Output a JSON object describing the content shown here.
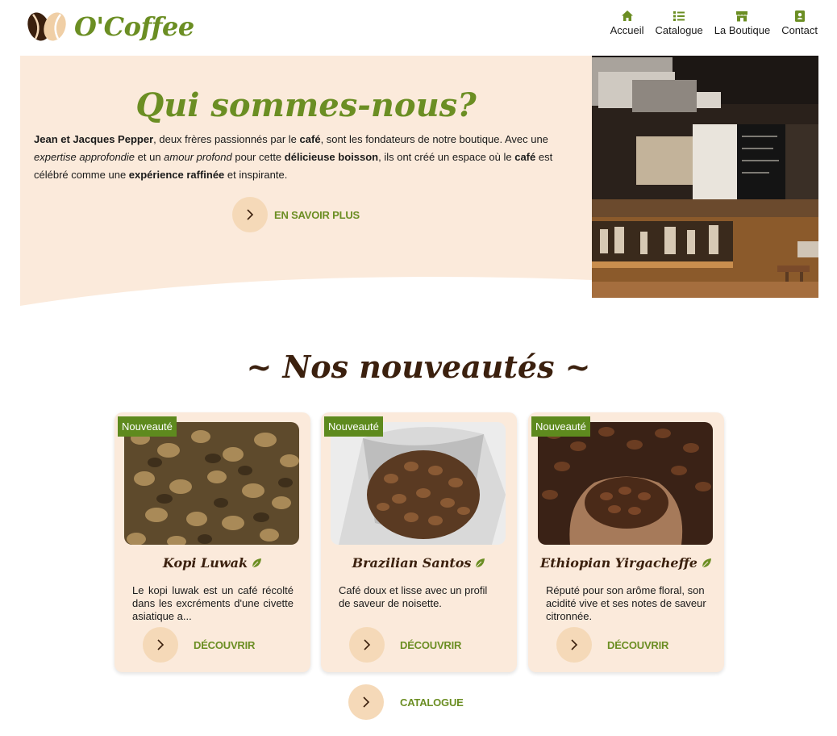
{
  "brand": {
    "name": "O'Coffee"
  },
  "nav": [
    {
      "label": "Accueil",
      "icon": "home-icon"
    },
    {
      "label": "Catalogue",
      "icon": "list-icon"
    },
    {
      "label": "La Boutique",
      "icon": "store-icon"
    },
    {
      "label": "Contact",
      "icon": "contact-card-icon"
    }
  ],
  "hero": {
    "title": "Qui sommes-nous?",
    "text_parts": [
      "Jean et Jacques Pepper",
      ", deux frères passionnés par le ",
      "café",
      ", sont les fondateurs de notre boutique. Avec une ",
      "expertise approfondie",
      " et un ",
      "amour profond",
      " pour cette ",
      "délicieuse boisson",
      ", ils ont créé un espace où le ",
      "café",
      " est célébré comme une ",
      "expérience raffinée",
      " et inspirante."
    ],
    "cta_label": "EN SAVOIR PLUS"
  },
  "section": {
    "title": "~ Nos nouveautés ~"
  },
  "products": [
    {
      "badge": "Nouveauté",
      "name": "Kopi Luwak",
      "description": "Le kopi luwak est un café récolté dans les excréments d'une civette asiatique a...",
      "cta": "DÉCOUVRIR"
    },
    {
      "badge": "Nouveauté",
      "name": "Brazilian Santos",
      "description": "Café doux et lisse avec un profil de saveur de noisette.",
      "cta": "DÉCOUVRIR"
    },
    {
      "badge": "Nouveauté",
      "name": "Ethiopian Yirgacheffe",
      "description": "Réputé pour son arôme floral, son acidité vive et ses notes de saveur citronnée.",
      "cta": "DÉCOUVRIR"
    }
  ],
  "catalogue_cta": "CATALOGUE",
  "colors": {
    "green": "#6b8e23",
    "badge_green": "#5e8a1e",
    "brown": "#3b200e",
    "cream": "#fbeadb",
    "circle": "#f5d9b8"
  }
}
